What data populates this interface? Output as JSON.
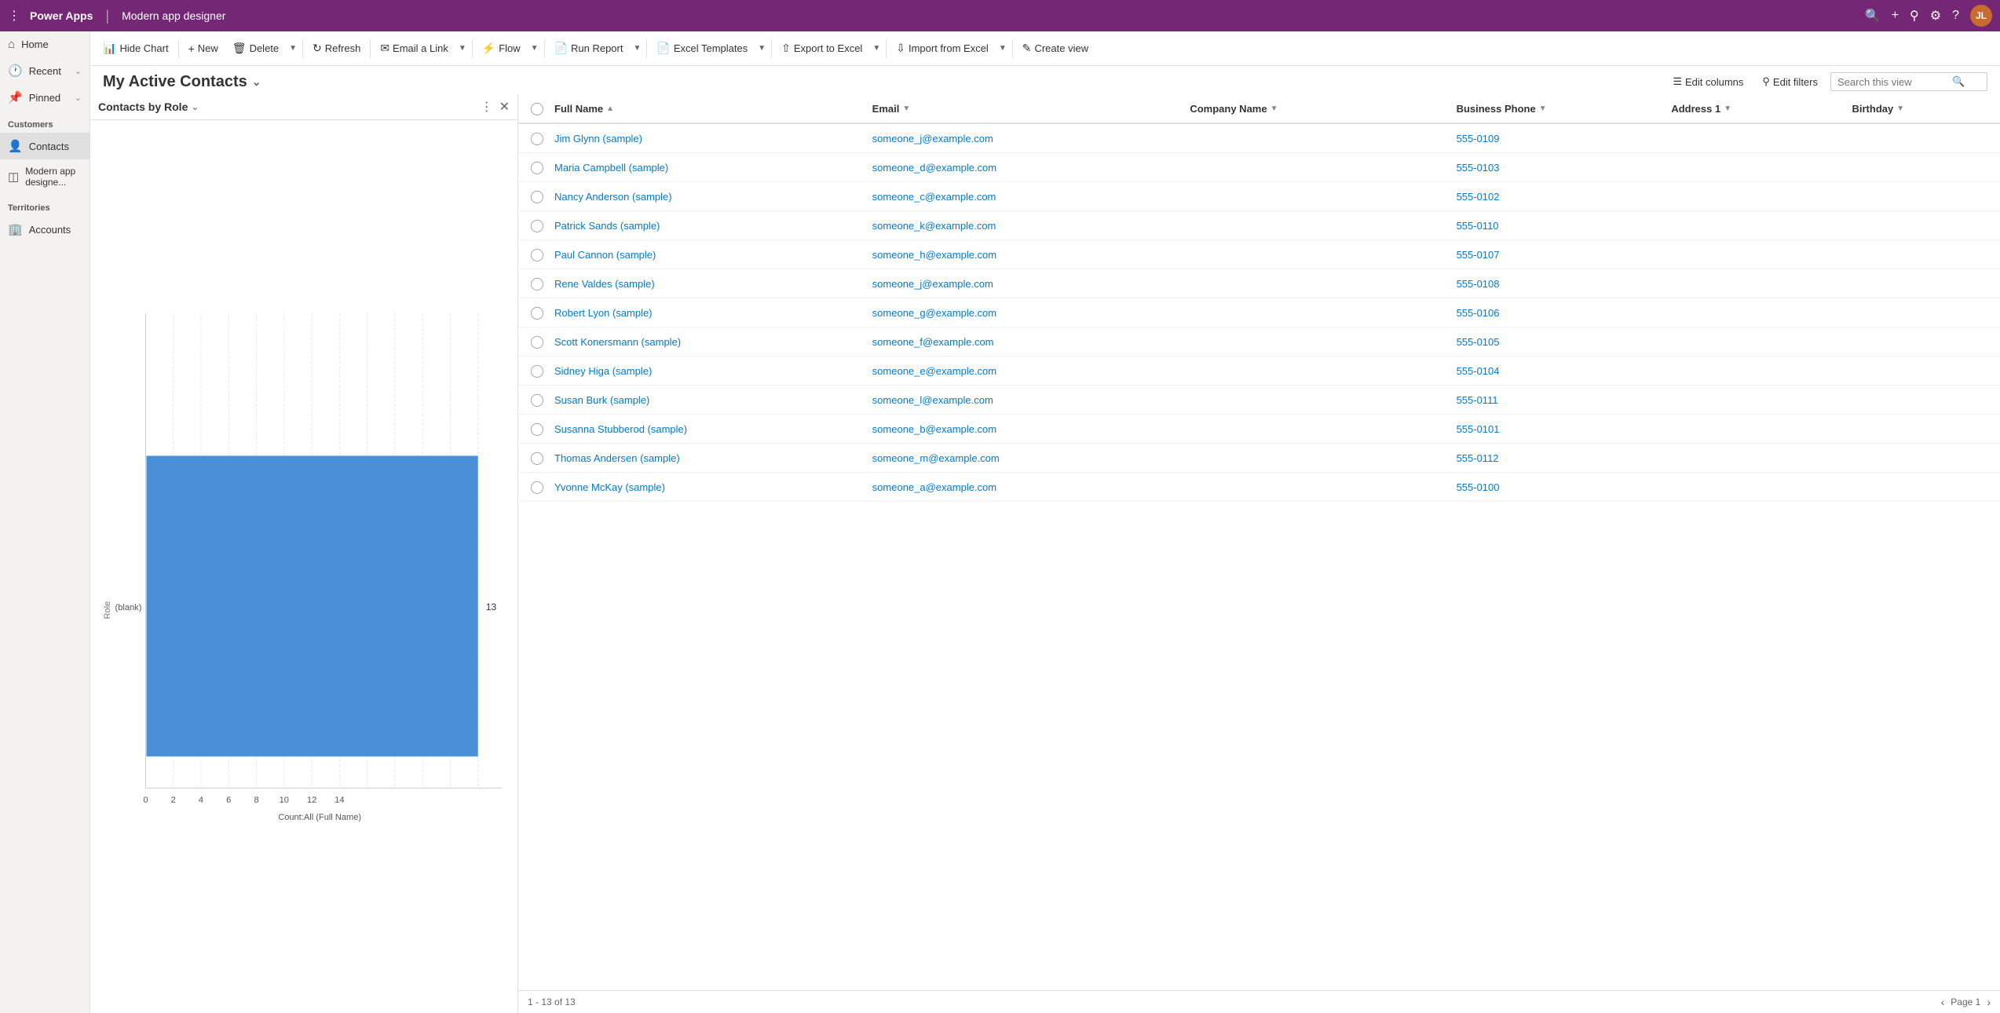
{
  "topbar": {
    "app_name": "Power Apps",
    "separator": "|",
    "module_name": "Modern app designer",
    "avatar_initials": "JL"
  },
  "command_bar": {
    "hide_chart": "Hide Chart",
    "new": "New",
    "delete": "Delete",
    "refresh": "Refresh",
    "email_a_link": "Email a Link",
    "flow": "Flow",
    "run_report": "Run Report",
    "excel_templates": "Excel Templates",
    "export_to_excel": "Export to Excel",
    "import_from_excel": "Import from Excel",
    "create_view": "Create view"
  },
  "view_header": {
    "title": "My Active Contacts",
    "edit_columns": "Edit columns",
    "edit_filters": "Edit filters",
    "search_placeholder": "Search this view"
  },
  "chart": {
    "title": "Contacts by Role",
    "x_label": "Count:All (Full Name)",
    "y_label": "Role",
    "blank_label": "(blank)",
    "bar_value": 13,
    "bar_color": "#4a90d9",
    "x_ticks": [
      "0",
      "2",
      "4",
      "6",
      "8",
      "10",
      "12",
      "14"
    ],
    "x_tick_vals": [
      0,
      2,
      4,
      6,
      8,
      10,
      12,
      14
    ]
  },
  "grid": {
    "columns": [
      {
        "id": "full_name",
        "label": "Full Name",
        "sort": "asc"
      },
      {
        "id": "email",
        "label": "Email"
      },
      {
        "id": "company_name",
        "label": "Company Name"
      },
      {
        "id": "business_phone",
        "label": "Business Phone"
      },
      {
        "id": "address1",
        "label": "Address 1"
      },
      {
        "id": "birthday",
        "label": "Birthday"
      }
    ],
    "rows": [
      {
        "full_name": "Jim Glynn (sample)",
        "email": "someone_j@example.com",
        "company": "",
        "phone": "555-0109",
        "address": "",
        "birthday": ""
      },
      {
        "full_name": "Maria Campbell (sample)",
        "email": "someone_d@example.com",
        "company": "",
        "phone": "555-0103",
        "address": "",
        "birthday": ""
      },
      {
        "full_name": "Nancy Anderson (sample)",
        "email": "someone_c@example.com",
        "company": "",
        "phone": "555-0102",
        "address": "",
        "birthday": ""
      },
      {
        "full_name": "Patrick Sands (sample)",
        "email": "someone_k@example.com",
        "company": "",
        "phone": "555-0110",
        "address": "",
        "birthday": ""
      },
      {
        "full_name": "Paul Cannon (sample)",
        "email": "someone_h@example.com",
        "company": "",
        "phone": "555-0107",
        "address": "",
        "birthday": ""
      },
      {
        "full_name": "Rene Valdes (sample)",
        "email": "someone_j@example.com",
        "company": "",
        "phone": "555-0108",
        "address": "",
        "birthday": ""
      },
      {
        "full_name": "Robert Lyon (sample)",
        "email": "someone_g@example.com",
        "company": "",
        "phone": "555-0106",
        "address": "",
        "birthday": ""
      },
      {
        "full_name": "Scott Konersmann (sample)",
        "email": "someone_f@example.com",
        "company": "",
        "phone": "555-0105",
        "address": "",
        "birthday": ""
      },
      {
        "full_name": "Sidney Higa (sample)",
        "email": "someone_e@example.com",
        "company": "",
        "phone": "555-0104",
        "address": "",
        "birthday": ""
      },
      {
        "full_name": "Susan Burk (sample)",
        "email": "someone_l@example.com",
        "company": "",
        "phone": "555-0111",
        "address": "",
        "birthday": ""
      },
      {
        "full_name": "Susanna Stubberod (sample)",
        "email": "someone_b@example.com",
        "company": "",
        "phone": "555-0101",
        "address": "",
        "birthday": ""
      },
      {
        "full_name": "Thomas Andersen (sample)",
        "email": "someone_m@example.com",
        "company": "",
        "phone": "555-0112",
        "address": "",
        "birthday": ""
      },
      {
        "full_name": "Yvonne McKay (sample)",
        "email": "someone_a@example.com",
        "company": "",
        "phone": "555-0100",
        "address": "",
        "birthday": ""
      }
    ],
    "footer": {
      "range": "1 - 13 of 13",
      "page_label": "Page 1"
    }
  },
  "sidebar": {
    "home": "Home",
    "recent": "Recent",
    "pinned": "Pinned",
    "customers_section": "Customers",
    "contacts": "Contacts",
    "modern_app_designer": "Modern app designe...",
    "territories_section": "Territories",
    "accounts": "Accounts"
  }
}
